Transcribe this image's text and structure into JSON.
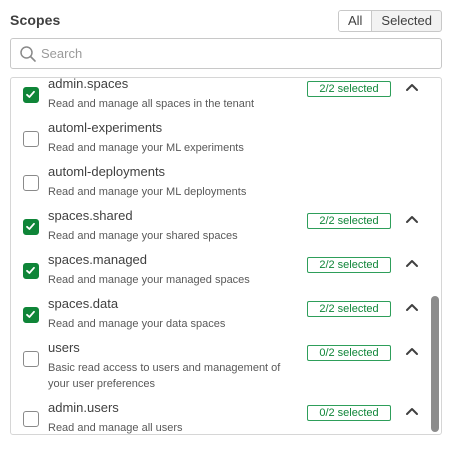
{
  "header": {
    "title": "Scopes"
  },
  "filter": {
    "all_label": "All",
    "selected_label": "Selected"
  },
  "search": {
    "placeholder": "Search"
  },
  "scopes": [
    {
      "name": "admin.spaces",
      "description": "Read and manage all spaces in the tenant",
      "checked": true,
      "badge": "2/2 selected",
      "expandable": true
    },
    {
      "name": "automl-experiments",
      "description": "Read and manage your ML experiments",
      "checked": false,
      "badge": "",
      "expandable": false
    },
    {
      "name": "automl-deployments",
      "description": "Read and manage your ML deployments",
      "checked": false,
      "badge": "",
      "expandable": false
    },
    {
      "name": "spaces.shared",
      "description": "Read and manage your shared spaces",
      "checked": true,
      "badge": "2/2 selected",
      "expandable": true
    },
    {
      "name": "spaces.managed",
      "description": "Read and manage your managed spaces",
      "checked": true,
      "badge": "2/2 selected",
      "expandable": true
    },
    {
      "name": "spaces.data",
      "description": "Read and manage your data spaces",
      "checked": true,
      "badge": "2/2 selected",
      "expandable": true
    },
    {
      "name": "users",
      "description": "Basic read access to users and management of your user preferences",
      "checked": false,
      "badge": "0/2 selected",
      "expandable": true
    },
    {
      "name": "admin.users",
      "description": "Read and manage all users",
      "checked": false,
      "badge": "0/2 selected",
      "expandable": true
    }
  ],
  "colors": {
    "accent_green": "#0f8538",
    "border": "#c8c8c8",
    "text": "#404040"
  },
  "icons": {
    "search": "search-icon",
    "check": "check-icon",
    "expand": "chevron-up-icon"
  }
}
